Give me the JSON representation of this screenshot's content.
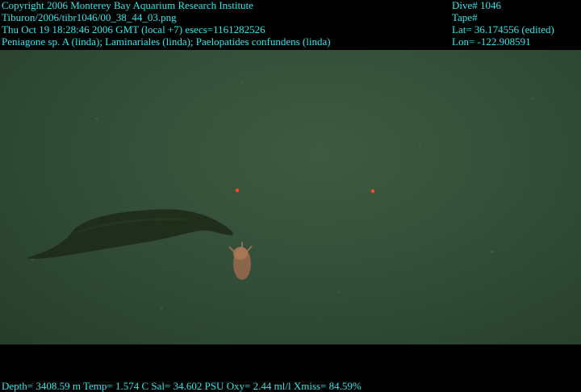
{
  "overlay": {
    "left_lines": [
      "Copyright 2006 Monterey Bay Aquarium Research Institute",
      "Tiburon/2006/tibr1046/00_38_44_03.png",
      "Thu Oct 19 18:28:46 2006 GMT (local +7)  esecs=1161282526",
      "Peniagone sp. A (linda); Laminariales (linda); Paelopatides confundens (linda)"
    ],
    "right_lines": [
      "Dive# 1046",
      "Tape#",
      "Lat= 36.174556 (edited)",
      "Lon= -122.908591"
    ],
    "bottom_line": "Depth= 3408.59 m  Temp= 1.574 C  Sal= 34.602 PSU  Oxy= 2.44 ml/l  Xmiss= 84.59%",
    "text_color": "#31e6e6"
  },
  "scene": {
    "background_color": "#33503a",
    "subjects": [
      "Laminariales kelp blade",
      "Peniagone sp. A sea cucumber",
      "laser scale dots"
    ]
  }
}
